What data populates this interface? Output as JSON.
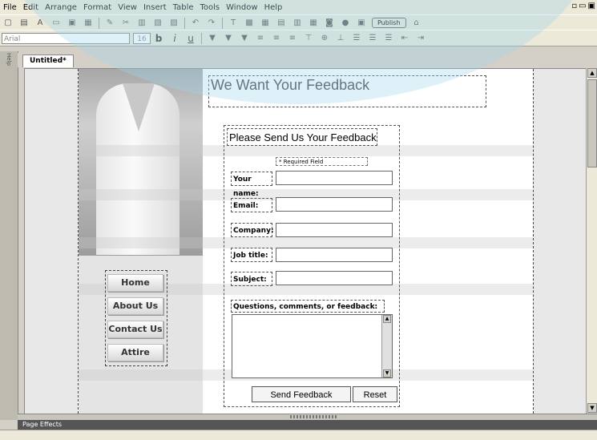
{
  "menubar": {
    "items": [
      "File",
      "Edit",
      "Arrange",
      "Format",
      "View",
      "Insert",
      "Table",
      "Tools",
      "Window",
      "Help"
    ]
  },
  "toolbar": {
    "font_name": "Arial",
    "font_size": "16",
    "publish_label": "Publish",
    "bold_glyph": "b",
    "italic_glyph": "i",
    "underline_glyph": "u"
  },
  "side_panel": {
    "label": "Help"
  },
  "document": {
    "tab_label": "Untitled*"
  },
  "page": {
    "headline": "We Want Your Feedback",
    "nav": [
      "Home",
      "About Us",
      "Contact Us",
      "Attire"
    ],
    "form": {
      "title": "Please Send Us Your Feedback",
      "required_note": "* Required Field",
      "fields": [
        {
          "label": "Your name:",
          "value": ""
        },
        {
          "label": "Email:",
          "value": ""
        },
        {
          "label": "Company:",
          "value": ""
        },
        {
          "label": "Job title:",
          "value": ""
        },
        {
          "label": "Subject:",
          "value": ""
        }
      ],
      "questions_label": "Questions, comments, or feedback:",
      "submit_label": "Send Feedback",
      "reset_label": "Reset"
    }
  },
  "statusbar": {
    "label": "Page Effects"
  },
  "colors": {
    "overlay": "#a0d7eb",
    "headline": "#444444"
  }
}
